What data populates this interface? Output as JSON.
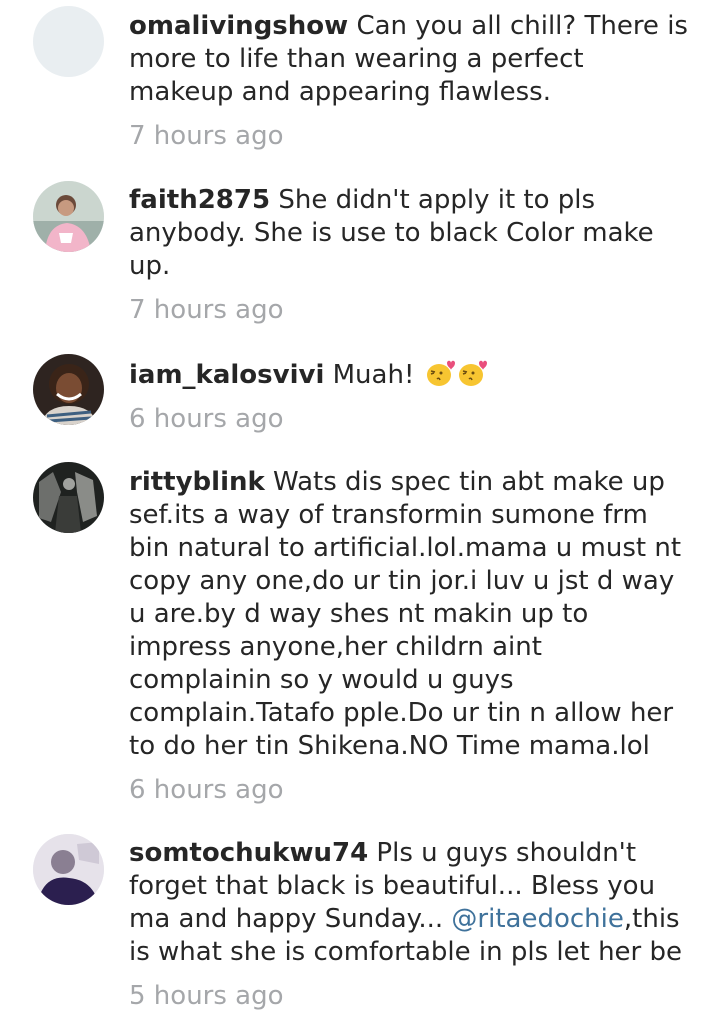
{
  "comments": [
    {
      "username": "omalivingshow",
      "text": "Can you all chill? There is more to life than wearing a perfect makeup and appearing flawless.",
      "time": "7 hours ago",
      "avatar": "blank-avatar-icon"
    },
    {
      "username": "faith2875",
      "text": "She didn't apply it to pls anybody. She is use to black Color make up.",
      "time": "7 hours ago",
      "avatar": "user-photo"
    },
    {
      "username": "iam_kalosvivi",
      "text": "Muah!",
      "emoji": [
        "kissing-face-icon",
        "kissing-face-icon"
      ],
      "time": "6 hours ago",
      "avatar": "user-photo"
    },
    {
      "username": "rittyblink",
      "text": "Wats dis spec tin abt make up sef.its a way of transformin sumone frm bin natural to artificial.lol.mama u must nt copy any one,do ur tin jor.i luv u jst d way u are.by d way shes nt makin up to impress anyone,her childrn aint complainin so y would u guys complain.Tatafo pple.Do ur tin n allow her to do her tin Shikena.NO Time mama.lol",
      "time": "6 hours ago",
      "avatar": "user-photo"
    },
    {
      "username": "somtochukwu74",
      "text_before": "Pls u guys shouldn't forget that black is beautiful... Bless you ma and happy Sunday...",
      "mention": "@ritaedochie",
      "text_after": ",this is what she is comfortable in pls let her be",
      "time": "5 hours ago",
      "avatar": "user-photo"
    }
  ],
  "colors": {
    "text": "#262626",
    "time": "#a5a7aa",
    "mention": "#3f729b",
    "emoji": "#f7c531",
    "heart": "#e94f7c"
  }
}
